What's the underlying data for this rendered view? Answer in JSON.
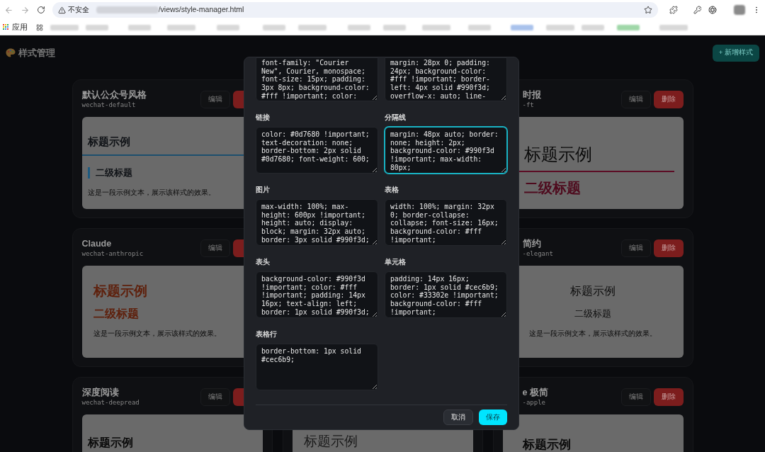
{
  "browser": {
    "security_label": "不安全",
    "url_path": "/views/style-manager.html",
    "apps_label": "应用"
  },
  "page": {
    "title": "样式管理",
    "add_button": "+ 新增样式"
  },
  "columns": [
    {
      "cards": [
        {
          "title": "默认公众号风格",
          "slug": "wechat-default",
          "buttons": [
            {
              "kind": "edit",
              "label": "编辑"
            },
            {
              "kind": "delete"
            }
          ],
          "preview": {
            "kind": "default",
            "heading": "标题示例",
            "subheading": "二级标题",
            "paragraph": "这是一段示例文本，展示该样式的效果。"
          }
        },
        {
          "title": "Claude",
          "slug": "wechat-anthropic",
          "buttons": [
            {
              "kind": "edit",
              "label": "编辑"
            },
            {
              "kind": "delete"
            }
          ],
          "preview": {
            "kind": "claude",
            "heading": "标题示例",
            "subheading": "二级标题",
            "paragraph": "这是一段示例文本，展示该样式的效果。"
          }
        },
        {
          "title": "深度阅读",
          "slug": "wechat-deepread",
          "buttons": [
            {
              "kind": "edit",
              "label": "编辑"
            },
            {
              "kind": "delete"
            }
          ],
          "preview": {
            "kind": "deepread",
            "heading": "标题示例"
          }
        }
      ]
    },
    {
      "cards": [
        {
          "preview": {
            "kind": "thin",
            "heading": "标题示例"
          }
        }
      ]
    },
    {
      "cards": [
        {
          "title": "时报",
          "slug": "-ft",
          "buttons": [
            {
              "kind": "edit",
              "label": "编辑"
            },
            {
              "kind": "delete",
              "label": "删除"
            }
          ],
          "preview": {
            "kind": "ft",
            "heading": "标题示例",
            "subheading": "二级标题"
          }
        },
        {
          "title": "简约",
          "slug": "-elegant",
          "buttons": [
            {
              "kind": "edit",
              "label": "编辑"
            },
            {
              "kind": "delete",
              "label": "删除"
            }
          ],
          "preview": {
            "kind": "elegant",
            "heading": "标题示例",
            "subheading": "二级标题",
            "paragraph": "这是一段示例文本，展示该样式的效果。"
          }
        },
        {
          "title": "e 极简",
          "slug": "-apple",
          "buttons": [
            {
              "kind": "edit",
              "label": "编辑"
            },
            {
              "kind": "delete",
              "label": "删除"
            }
          ],
          "preview": {
            "kind": "apple",
            "heading": "标题示例"
          }
        }
      ]
    }
  ],
  "modal": {
    "fields": [
      {
        "value": "font-family: \"Courier New\", Courier, monospace; font-size: 15px; padding: 3px 8px; background-color: #fff !important; color:",
        "focused": false
      },
      {
        "value": "margin: 28px 0; padding: 24px; background-color: #fff !important; border-left: 4px solid #990f3d; overflow-x: auto; line-",
        "focused": false
      },
      {
        "label": "链接",
        "value": "color: #0d7680 !important; text-decoration: none; border-bottom: 2px solid #0d7680; font-weight: 600;",
        "focused": false
      },
      {
        "label": "分隔线",
        "value": "margin: 48px auto; border: none; height: 2px; background-color: #990f3d !important; max-width: 80px;",
        "focused": true
      },
      {
        "label": "图片",
        "value": "max-width: 100%; max-height: 600px !important; height: auto; display: block; margin: 32px auto; border: 3px solid #990f3d;",
        "focused": false
      },
      {
        "label": "表格",
        "value": "width: 100%; margin: 32px 0; border-collapse: collapse; font-size: 16px; background-color: #fff !important;",
        "focused": false
      },
      {
        "label": "表头",
        "value": "background-color: #990f3d !important; color: #fff !important; padding: 14px 16px; text-align: left; border: 1px solid #990f3d;",
        "focused": false
      },
      {
        "label": "单元格",
        "value": "padding: 14px 16px; border: 1px solid #cec6b9; color: #33302e !important; background-color: #fff !important;",
        "focused": false
      },
      {
        "label": "表格行",
        "value": "border-bottom: 1px solid #cec6b9;",
        "focused": false
      }
    ],
    "buttons": [
      {
        "kind": "secondary",
        "label": "取消"
      },
      {
        "kind": "primary",
        "label": "保存"
      }
    ]
  }
}
